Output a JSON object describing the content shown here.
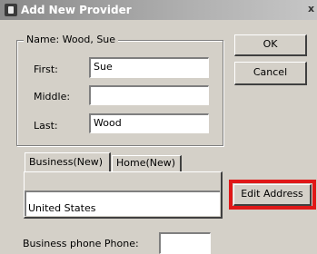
{
  "window": {
    "title": "Add New Provider",
    "close_glyph": "x"
  },
  "name_group": {
    "legend": "Name: Wood, Sue",
    "first_label": "First:",
    "first_value": "Sue",
    "middle_label": "Middle:",
    "middle_value": "",
    "last_label": "Last:",
    "last_value": "Wood"
  },
  "buttons": {
    "ok": "OK",
    "cancel": "Cancel",
    "edit_address": "Edit Address"
  },
  "tabs": [
    {
      "label": "Business(New)"
    },
    {
      "label": "Home(New)"
    }
  ],
  "address": {
    "country": "United States"
  },
  "phone": {
    "label": "Business phone Phone:",
    "value": ""
  },
  "colors": {
    "highlight": "#e01818",
    "dialog_bg": "#d4d0c8"
  },
  "icons": {
    "window_icon": "app-icon"
  }
}
